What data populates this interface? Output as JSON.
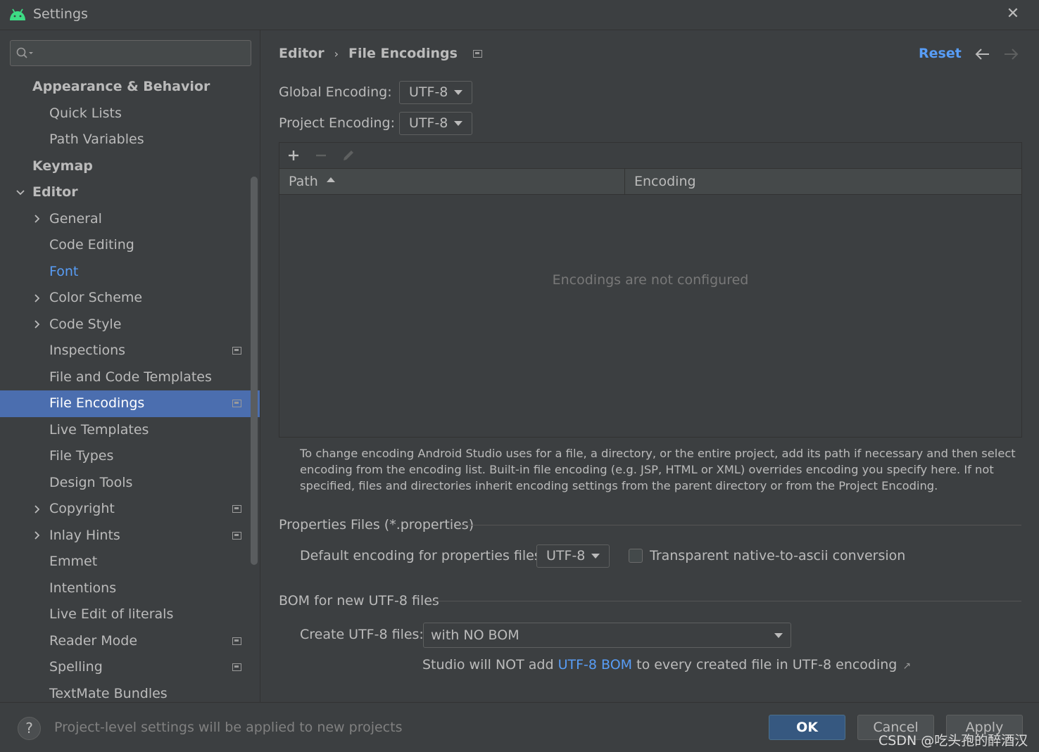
{
  "window": {
    "title": "Settings",
    "close_icon": "close-icon"
  },
  "search": {
    "placeholder": "",
    "icon": "search-icon"
  },
  "sidebar": {
    "items": [
      {
        "label": "Appearance & Behavior",
        "level": 0,
        "expandable": false
      },
      {
        "label": "Quick Lists",
        "level": 1,
        "expandable": false
      },
      {
        "label": "Path Variables",
        "level": 1,
        "expandable": false
      },
      {
        "label": "Keymap",
        "level": 0,
        "expandable": false
      },
      {
        "label": "Editor",
        "level": 0,
        "expandable": true,
        "expanded": true
      },
      {
        "label": "General",
        "level": 1,
        "expandable": true
      },
      {
        "label": "Code Editing",
        "level": 1,
        "expandable": false
      },
      {
        "label": "Font",
        "level": 1,
        "expandable": false,
        "link": true
      },
      {
        "label": "Color Scheme",
        "level": 1,
        "expandable": true
      },
      {
        "label": "Code Style",
        "level": 1,
        "expandable": true
      },
      {
        "label": "Inspections",
        "level": 1,
        "expandable": false,
        "badge": true
      },
      {
        "label": "File and Code Templates",
        "level": 1,
        "expandable": false
      },
      {
        "label": "File Encodings",
        "level": 1,
        "expandable": false,
        "badge": true,
        "selected": true
      },
      {
        "label": "Live Templates",
        "level": 1,
        "expandable": false
      },
      {
        "label": "File Types",
        "level": 1,
        "expandable": false
      },
      {
        "label": "Design Tools",
        "level": 1,
        "expandable": false
      },
      {
        "label": "Copyright",
        "level": 1,
        "expandable": true,
        "badge": true
      },
      {
        "label": "Inlay Hints",
        "level": 1,
        "expandable": true,
        "badge": true
      },
      {
        "label": "Emmet",
        "level": 1,
        "expandable": false
      },
      {
        "label": "Intentions",
        "level": 1,
        "expandable": false
      },
      {
        "label": "Live Edit of literals",
        "level": 1,
        "expandable": false
      },
      {
        "label": "Reader Mode",
        "level": 1,
        "expandable": false,
        "badge": true
      },
      {
        "label": "Spelling",
        "level": 1,
        "expandable": false,
        "badge": true
      },
      {
        "label": "TextMate Bundles",
        "level": 1,
        "expandable": false
      }
    ]
  },
  "breadcrumb": {
    "parent": "Editor",
    "current": "File Encodings",
    "separator": "›"
  },
  "header": {
    "reset_label": "Reset"
  },
  "encodings": {
    "global_label": "Global Encoding:",
    "global_value": "UTF-8",
    "project_label": "Project Encoding:",
    "project_value": "UTF-8"
  },
  "table": {
    "columns": [
      "Path",
      "Encoding"
    ],
    "empty_text": "Encodings are not configured"
  },
  "help_text": "To change encoding Android Studio uses for a file, a directory, or the entire project, add its path if necessary and then select encoding from the encoding list. Built-in file encoding (e.g. JSP, HTML or XML) overrides encoding you specify here. If not specified, files and directories inherit encoding settings from the parent directory or from the Project Encoding.",
  "properties": {
    "group_title": "Properties Files (*.properties)",
    "default_label": "Default encoding for properties files:",
    "default_value": "UTF-8",
    "transparent_label": "Transparent native-to-ascii conversion",
    "transparent_checked": false
  },
  "bom": {
    "group_title": "BOM for new UTF-8 files",
    "create_label": "Create UTF-8 files:",
    "create_value": "with NO BOM",
    "note_before": "Studio will NOT add ",
    "note_link": "UTF-8 BOM",
    "note_after": " to every created file in UTF-8 encoding"
  },
  "footer": {
    "help_label": "?",
    "note": "Project-level settings will be applied to new projects",
    "ok_label": "OK",
    "cancel_label": "Cancel",
    "apply_label": "Apply"
  },
  "watermark": "CSDN @吃头孢的醉酒汉",
  "colors": {
    "accent": "#589df6",
    "selection": "#4b6eaf",
    "background": "#3c3f41",
    "ok_button": "#365880"
  }
}
